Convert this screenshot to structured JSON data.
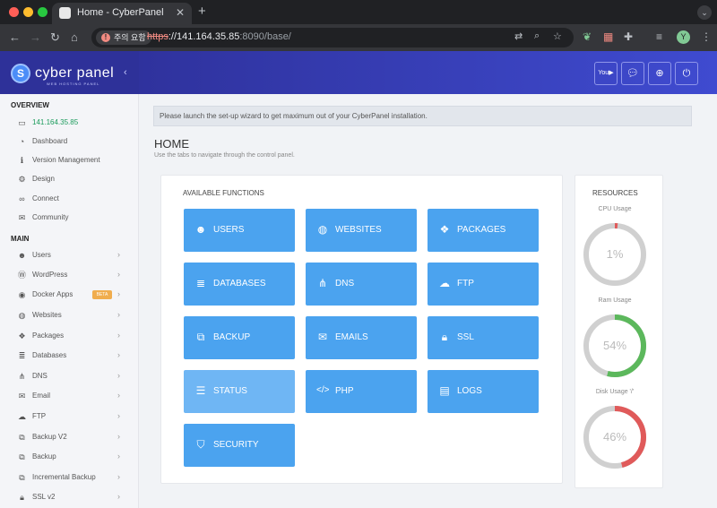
{
  "browser": {
    "tab_title": "Home - CyberPanel",
    "warning_label": "주의 요함",
    "url_scheme": "https",
    "url_rest": "://141.164.35.85",
    "url_path": ":8090/base/",
    "profile_initial": "Y"
  },
  "brand": {
    "name": "cyber panel",
    "subtitle": "WEB HOSTING PANEL"
  },
  "sidebar": {
    "overview_label": "OVERVIEW",
    "main_label": "MAIN",
    "overview_items": [
      {
        "label": "141.164.35.85",
        "icon": "laptop-icon"
      },
      {
        "label": "Dashboard",
        "icon": "dashboard-icon"
      },
      {
        "label": "Version Management",
        "icon": "info-icon"
      },
      {
        "label": "Design",
        "icon": "gear-icon"
      },
      {
        "label": "Connect",
        "icon": "link-icon"
      },
      {
        "label": "Community",
        "icon": "comments-icon"
      }
    ],
    "main_items": [
      {
        "label": "Users",
        "icon": "users-icon"
      },
      {
        "label": "WordPress",
        "icon": "wordpress-icon"
      },
      {
        "label": "Docker Apps",
        "icon": "docker-icon",
        "badge": "BETA"
      },
      {
        "label": "Websites",
        "icon": "globe-icon"
      },
      {
        "label": "Packages",
        "icon": "cubes-icon"
      },
      {
        "label": "Databases",
        "icon": "database-icon"
      },
      {
        "label": "DNS",
        "icon": "sitemap-icon"
      },
      {
        "label": "Email",
        "icon": "envelope-icon"
      },
      {
        "label": "FTP",
        "icon": "cloud-upload-icon"
      },
      {
        "label": "Backup V2",
        "icon": "backup-icon"
      },
      {
        "label": "Backup",
        "icon": "copy-icon"
      },
      {
        "label": "Incremental Backup",
        "icon": "copy-icon"
      },
      {
        "label": "SSL v2",
        "icon": "lock-icon"
      }
    ]
  },
  "notice": "Please launch the set-up wizard to get maximum out of your CyberPanel installation.",
  "home": {
    "title": "HOME",
    "subtitle": "Use the tabs to navigate through the control panel."
  },
  "functions": {
    "heading": "AVAILABLE FUNCTIONS",
    "items": [
      {
        "label": "USERS",
        "icon": "users-icon"
      },
      {
        "label": "WEBSITES",
        "icon": "globe-icon"
      },
      {
        "label": "PACKAGES",
        "icon": "cubes-icon"
      },
      {
        "label": "DATABASES",
        "icon": "database-icon"
      },
      {
        "label": "DNS",
        "icon": "sitemap-icon"
      },
      {
        "label": "FTP",
        "icon": "cloud-upload-icon"
      },
      {
        "label": "BACKUP",
        "icon": "copy-icon"
      },
      {
        "label": "EMAILS",
        "icon": "envelope-icon"
      },
      {
        "label": "SSL",
        "icon": "lock-icon"
      },
      {
        "label": "STATUS",
        "icon": "server-icon"
      },
      {
        "label": "PHP",
        "icon": "code-icon"
      },
      {
        "label": "LOGS",
        "icon": "file-icon"
      },
      {
        "label": "SECURITY",
        "icon": "shield-icon"
      }
    ]
  },
  "resources": {
    "heading": "RESOURCES",
    "gauges": [
      {
        "label": "CPU Usage",
        "value": "1%",
        "percent": 1,
        "color": "#e05a5a"
      },
      {
        "label": "Ram Usage",
        "value": "54%",
        "percent": 54,
        "color": "#5cb85c"
      },
      {
        "label": "Disk Usage '/'",
        "value": "46%",
        "percent": 46,
        "color": "#e05a5a"
      }
    ]
  },
  "colors": {
    "accent": "#2f329d",
    "button": "#4ba3ef"
  }
}
